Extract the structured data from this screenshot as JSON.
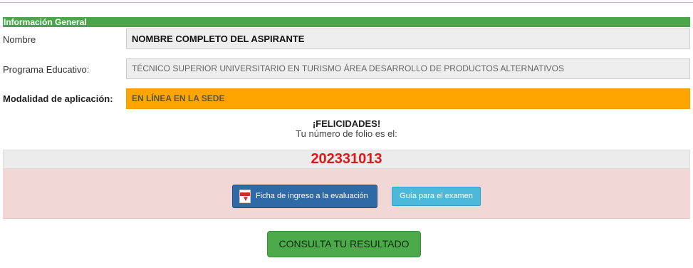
{
  "section": {
    "header": "Información General"
  },
  "fields": {
    "nombre": {
      "label": "Nombre",
      "value": "NOMBRE COMPLETO DEL ASPIRANTE"
    },
    "programa": {
      "label": "Programa Educativo:",
      "value": "TÉCNICO SUPERIOR UNIVERSITARIO EN TURISMO ÁREA DESARROLLO DE PRODUCTOS ALTERNATIVOS"
    },
    "modalidad": {
      "label": "Modalidad de aplicación:",
      "value": "EN LÍNEA EN LA SEDE"
    }
  },
  "result": {
    "title": "¡FELICIDADES!",
    "subtitle": "Tu número de folio es el:",
    "folio": "202331013"
  },
  "actions": {
    "ficha_label": "Ficha de ingreso a la evaluación",
    "guia_label": "Guía para el examen",
    "consulta_label": "CONSULTA TU RESULTADO"
  },
  "colors": {
    "header_green": "#4aa64a",
    "modality_orange": "#ffa500",
    "folio_red": "#e0161b",
    "panel_pink": "#f2d7d7",
    "ficha_blue": "#2f6aa6",
    "guia_cyan": "#4cb9da",
    "consulta_green": "#4caa4a"
  },
  "icons": {
    "ficha": "pdf-download-icon"
  }
}
